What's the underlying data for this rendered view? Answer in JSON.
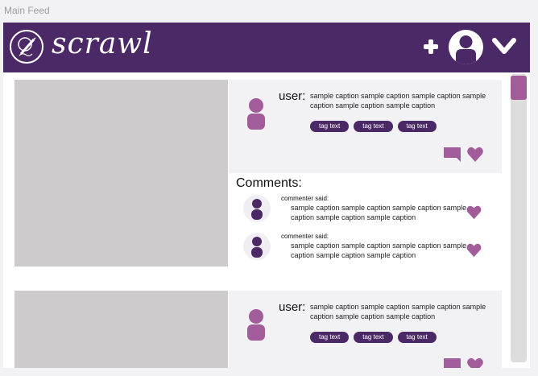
{
  "frame": {
    "label": "Main Feed"
  },
  "header": {
    "brand": "scrawl",
    "colors": {
      "bar": "#4a2966",
      "accent": "#a25c9a"
    },
    "actions": [
      "plus-icon",
      "profile-avatar-icon",
      "chevron-down-icon"
    ]
  },
  "posts": [
    {
      "user_label": "user:",
      "caption": "sample caption sample caption sample caption sample caption sample caption sample caption",
      "tags": [
        "tag text",
        "tag text",
        "tag text"
      ],
      "comments_title": "Comments:",
      "comments": [
        {
          "who": "commenter said:",
          "text": "sample caption sample caption sample caption sample caption sample caption sample caption"
        },
        {
          "who": "commenter said:",
          "text": "sample caption sample caption sample caption sample caption sample caption sample caption"
        }
      ]
    },
    {
      "user_label": "user:",
      "caption": "sample caption sample caption sample caption sample caption sample caption sample caption",
      "tags": [
        "tag text",
        "tag text",
        "tag text"
      ]
    }
  ]
}
